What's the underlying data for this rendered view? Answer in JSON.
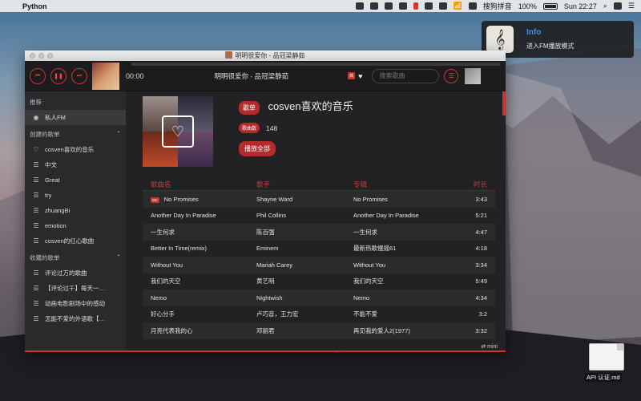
{
  "menubar": {
    "app_name": "Python",
    "ime": "搜狗拼音",
    "battery": "100%",
    "clock": "Sun 22:27"
  },
  "notification": {
    "title": "Info",
    "body": "进入FM播放模式"
  },
  "window": {
    "title": "明明很爱你 - 品冠梁静茹"
  },
  "player": {
    "time": "00:00",
    "song": "明明很爱你 - 品冠梁静茹",
    "quality_badge": "高",
    "search_placeholder": "搜索歌曲"
  },
  "sidebar": {
    "recommend_label": "推荐",
    "fm_label": "私人FM",
    "created_label": "创建的歌单",
    "created_items": [
      "cosven喜欢的音乐",
      "中文",
      "Great",
      "try",
      "zhuangBi",
      "emotion",
      "cosven的红心歌曲"
    ],
    "collected_label": "收藏的歌单",
    "collected_items": [
      "评论过万的歌曲",
      "【评论过千】每天一…",
      "动画电影剧场中的感动",
      "怎能不爱的外语歌【…"
    ]
  },
  "playlist": {
    "tag": "歌单",
    "title": "cosven喜欢的音乐",
    "count_label": "歌曲数",
    "count": "148",
    "play_all": "播放全部"
  },
  "table": {
    "headers": [
      "歌曲名",
      "歌手",
      "专辑",
      "时长"
    ],
    "rows": [
      {
        "name": "No Promises",
        "artist": "Shayne Ward",
        "album": "No Promises",
        "duration": "3:43",
        "mv": "MV"
      },
      {
        "name": "Another Day In Paradise",
        "artist": "Phil Collins",
        "album": "Another Day In Paradise",
        "duration": "5:21"
      },
      {
        "name": "一生何求",
        "artist": "陈百强",
        "album": "一生何求",
        "duration": "4:47"
      },
      {
        "name": "Better In Time(remix)",
        "artist": "Eminem",
        "album": "最新热歌慢摇61",
        "duration": "4:18"
      },
      {
        "name": "Without You",
        "artist": "Mariah Carey",
        "album": "Without You",
        "duration": "3:34"
      },
      {
        "name": "我们的天空",
        "artist": "黄艺明",
        "album": "我们的天空",
        "duration": "5:49"
      },
      {
        "name": "Nemo",
        "artist": "Nightwish",
        "album": "Nemo",
        "duration": "4:34"
      },
      {
        "name": "好心分手",
        "artist": "卢巧音，王力宏",
        "album": "不能不爱",
        "duration": "3:2"
      },
      {
        "name": "月亮代表我的心",
        "artist": "邓丽君",
        "album": "再见我的爱人2(1977)",
        "duration": "3:32"
      }
    ]
  },
  "mini_label": "mini",
  "desktop_file": "API 认证.md"
}
